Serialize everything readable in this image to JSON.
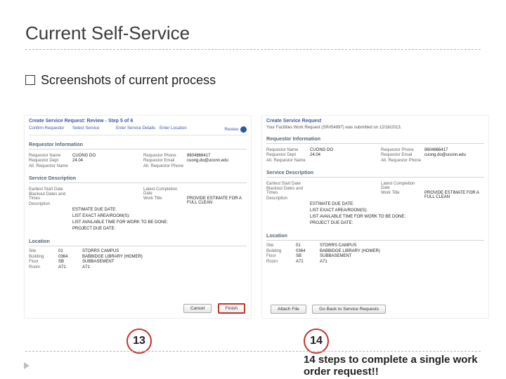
{
  "title": "Current Self-Service",
  "subtitle": "Screenshots of current process",
  "left": {
    "header": "Create Service Request: Review - Step 5 of 6",
    "steps": [
      "Confirm Requestor",
      "Select Service",
      "Enter Service Details",
      "Enter Location",
      "Review"
    ],
    "sec_req": "Requestor Information",
    "req_name_l": "Requestor Name",
    "req_name_v": "CUONG DO",
    "req_phone_l": "Requestor Phone",
    "req_phone_v": "8604866417",
    "req_dept_l": "Requestor Dept",
    "req_dept_v": "24.04",
    "req_email_l": "Requestor Email",
    "req_email_v": "cuong.do@uconn.edu",
    "alt_l": "Alt. Requestor Name",
    "alt_ph_l": "Alt. Requestor Phone",
    "sec_svc": "Service Description",
    "esd_l": "Earliest Start Date",
    "lcd_l": "Latest Completion Date",
    "bdt_l": "Blackout Dates and Times",
    "wt_l": "Work Title",
    "wt_v": "PROVIDE ESTIMATE FOR A FULL CLEAN",
    "desc_l": "Description",
    "desc_lines": [
      "ESTIMATE DUE DATE:",
      "LIST EXACT AREA/ROOM(S):",
      "LIST AVAILABLE TIME FOR WORK TO BE DONE:",
      "PROJECT DUE DATE:"
    ],
    "sec_loc": "Location",
    "site_l": "Site",
    "site_v": "01",
    "campus": "STORRS CAMPUS",
    "bldg_l": "Building",
    "bldg_v": "0364",
    "bldg_name": "BABBIDGE LIBRARY (HOMER)",
    "floor_l": "Floor",
    "floor_v": "SB",
    "floor_name": "SUBBASEMENT",
    "room_l": "Room",
    "room_v": "A71",
    "room_name": "A71",
    "btn_cancel": "Cancel",
    "btn_finish": "Finish"
  },
  "right": {
    "header": "Create Service Request",
    "submitted": "Your Facilities Work Request (SR#54897) was submitted on 12/16/2013.",
    "btn_attach": "Attach File",
    "btn_back": "Go Back to Service Requests"
  },
  "circle13": "13",
  "circle14": "14",
  "footer": "14 steps to complete a single work order request!!"
}
